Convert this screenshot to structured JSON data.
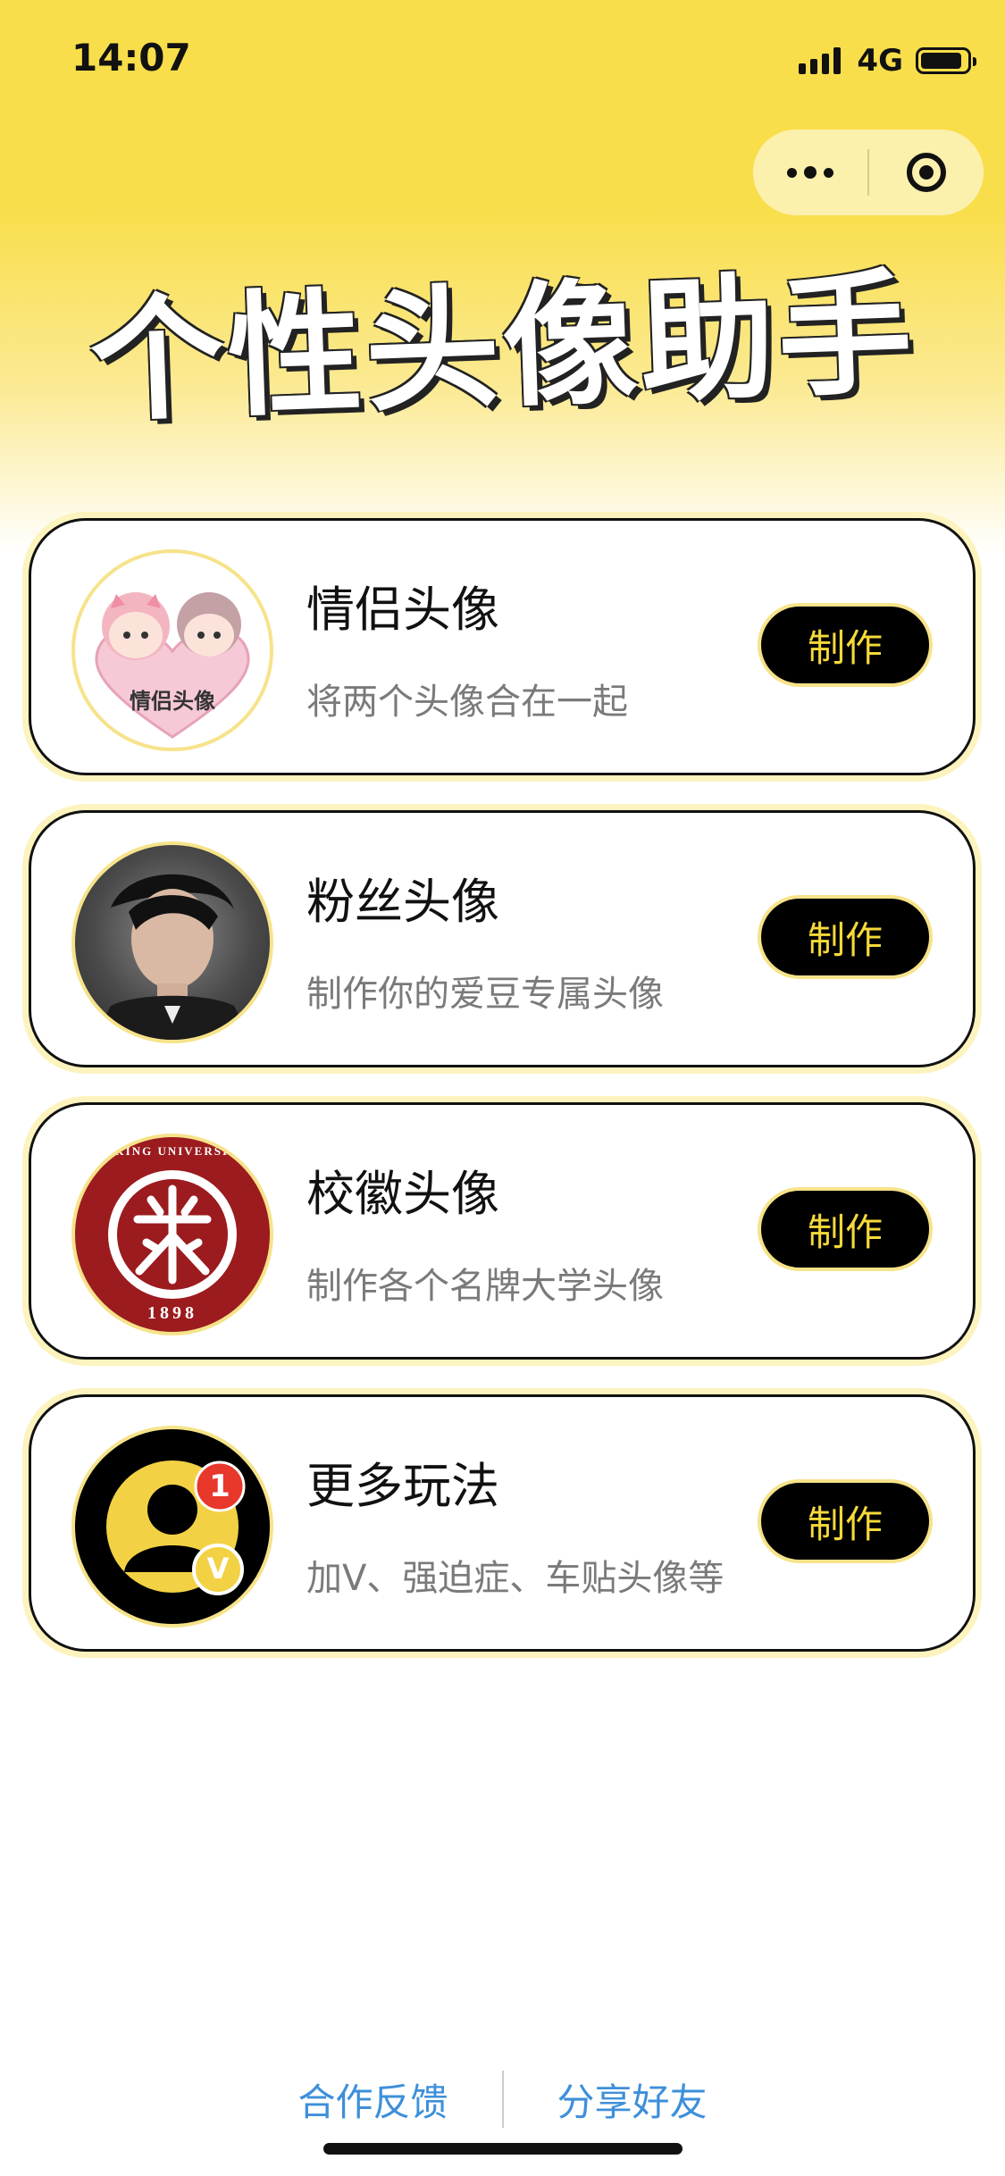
{
  "status": {
    "time": "14:07",
    "network": "4G"
  },
  "title": "个性头像助手",
  "cards": [
    {
      "title": "情侣头像",
      "subtitle": "将两个头像合在一起",
      "button": "制作",
      "badge_text": "情侣头像"
    },
    {
      "title": "粉丝头像",
      "subtitle": "制作你的爱豆专属头像",
      "button": "制作"
    },
    {
      "title": "校徽头像",
      "subtitle": "制作各个名牌大学头像",
      "button": "制作",
      "emblem_text": "PEKING UNIVERSITY",
      "emblem_year": "1898"
    },
    {
      "title": "更多玩法",
      "subtitle": "加V、强迫症、车贴头像等",
      "button": "制作",
      "notification_count": "1",
      "v_badge": "V"
    }
  ],
  "footer": {
    "feedback": "合作反馈",
    "share": "分享好友"
  },
  "colors": {
    "accent_yellow": "#F9DE4B",
    "button_bg": "#000000",
    "button_text": "#F5D93A",
    "link_blue": "#3E8FDA"
  }
}
